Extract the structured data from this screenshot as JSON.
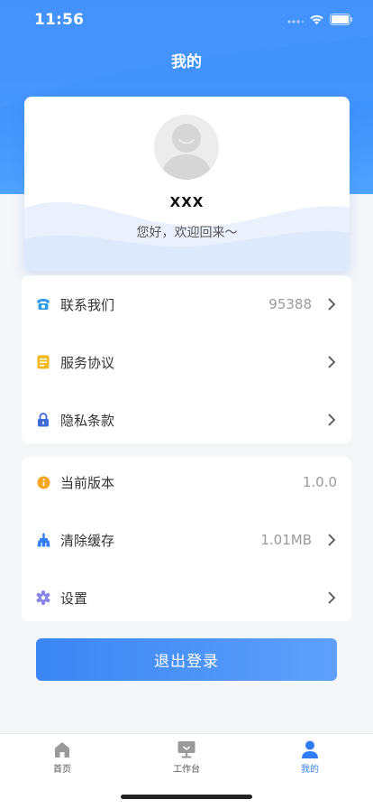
{
  "status_bar": {
    "time": "11:56"
  },
  "header": {
    "title": "我的"
  },
  "profile": {
    "username": "XXX",
    "greeting": "您好，欢迎回来～"
  },
  "menu_group_1": [
    {
      "icon": "phone-icon",
      "label": "联系我们",
      "value": "95388",
      "arrow": true
    },
    {
      "icon": "document-icon",
      "label": "服务协议",
      "value": "",
      "arrow": true
    },
    {
      "icon": "lock-icon",
      "label": "隐私条款",
      "value": "",
      "arrow": true
    }
  ],
  "menu_group_2": [
    {
      "icon": "info-icon",
      "label": "当前版本",
      "value": "1.0.0",
      "arrow": false
    },
    {
      "icon": "broom-icon",
      "label": "清除缓存",
      "value": "1.01MB",
      "arrow": true
    },
    {
      "icon": "gear-icon",
      "label": "设置",
      "value": "",
      "arrow": true
    }
  ],
  "logout": {
    "label": "退出登录"
  },
  "tabbar": [
    {
      "icon": "home-icon",
      "label": "首页",
      "active": false
    },
    {
      "icon": "workbench-icon",
      "label": "工作台",
      "active": false
    },
    {
      "icon": "user-icon",
      "label": "我的",
      "active": true
    }
  ],
  "colors": {
    "primary": "#3a8bfb",
    "active_tab": "#2f7cf6",
    "phone_icon": "#2f9be8",
    "document_icon": "#f5b825",
    "lock_icon": "#3f6ad8",
    "info_icon": "#f5a623",
    "broom_icon": "#2f7cf6",
    "gear_icon": "#8a86e8"
  }
}
